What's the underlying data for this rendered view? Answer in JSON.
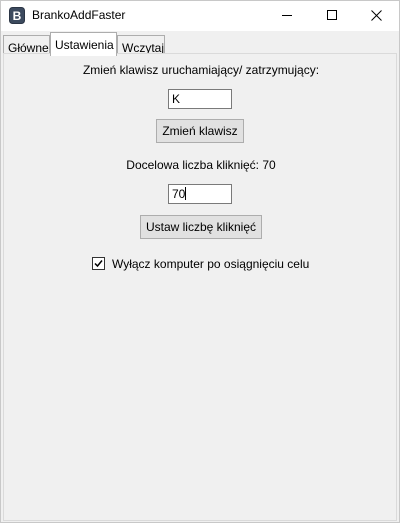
{
  "window": {
    "title": "BrankoAddFaster",
    "icon": "app-b-icon"
  },
  "titlebar_buttons": [
    {
      "name": "minimize",
      "icon": "minimize-icon"
    },
    {
      "name": "maximize",
      "icon": "maximize-icon"
    },
    {
      "name": "close",
      "icon": "close-icon"
    }
  ],
  "tabs": [
    {
      "label": "Główne",
      "selected": false
    },
    {
      "label": "Ustawienia",
      "selected": true
    },
    {
      "label": "Wczytaj",
      "selected": false
    }
  ],
  "settings": {
    "hotkey_label": "Zmień klawisz uruchamiający/ zatrzymujący:",
    "hotkey_value": "K",
    "change_key_button": "Zmień klawisz",
    "target_clicks_label": "Docelowa liczba kliknięć: 70",
    "target_clicks_value": "70",
    "set_clicks_button": "Ustaw liczbę kliknięć",
    "shutdown_checkbox_label": "Wyłącz komputer po osiągnięciu celu",
    "shutdown_checked": true
  }
}
